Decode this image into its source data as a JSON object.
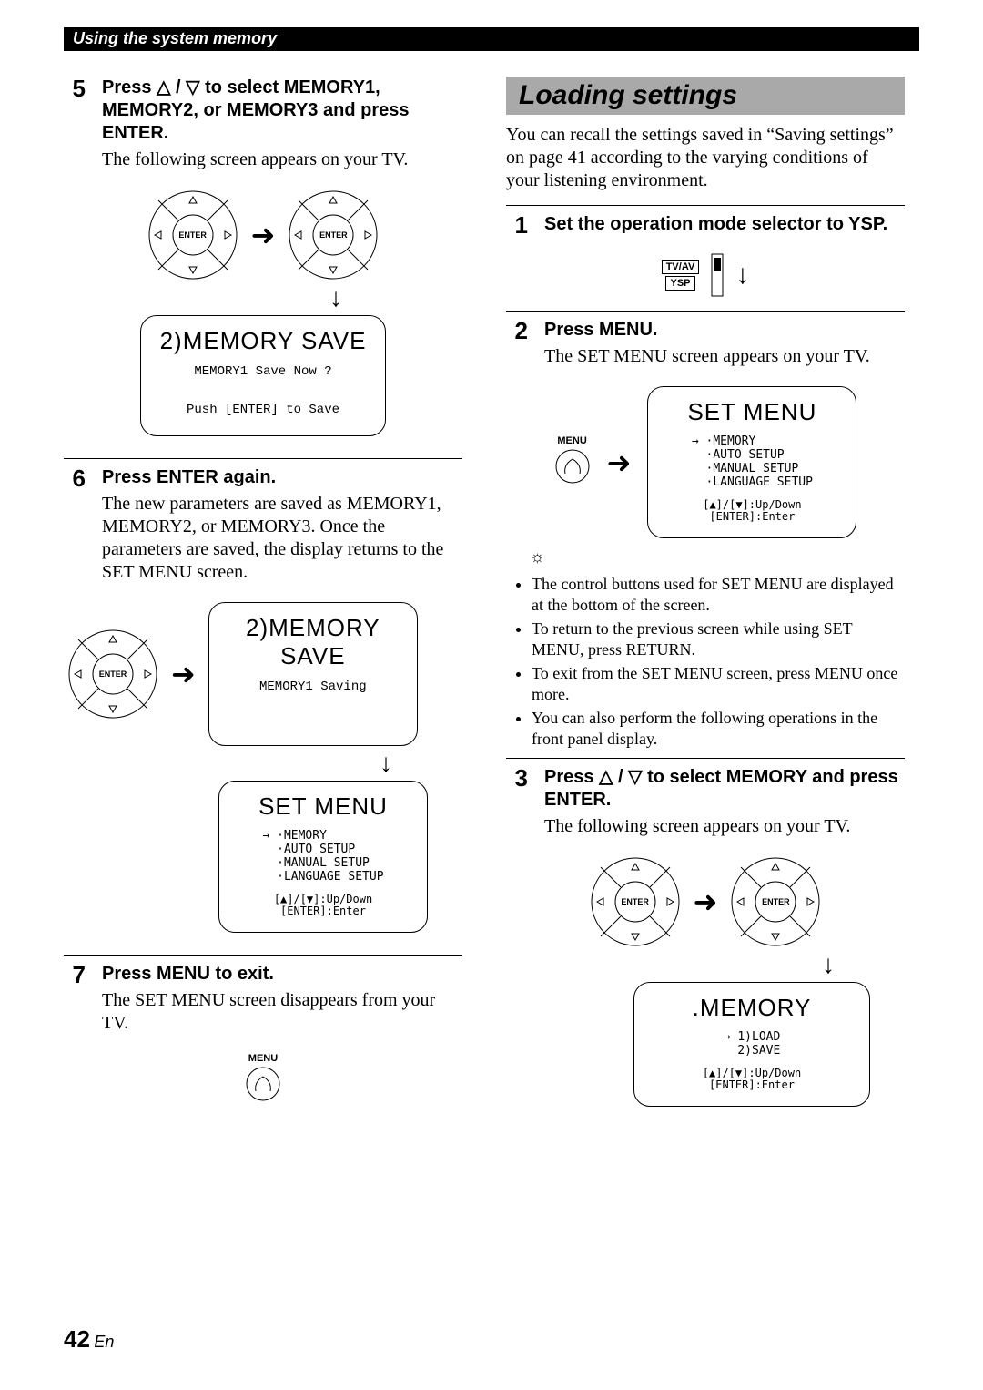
{
  "section_header": "Using the system memory",
  "left": {
    "step5": {
      "num": "5",
      "title_a": "Press ",
      "title_b": " / ",
      "title_c": " to select MEMORY1, MEMORY2, or MEMORY3 and press ENTER.",
      "text": "The following screen appears on your TV.",
      "enter": "ENTER",
      "enter2": "ENTER",
      "tv_title": "2)MEMORY SAVE",
      "tv_line1": "MEMORY1 Save Now ?",
      "tv_line2": "Push [ENTER] to Save"
    },
    "step6": {
      "num": "6",
      "title": "Press ENTER again.",
      "text": "The new parameters are saved as MEMORY1, MEMORY2, or MEMORY3. Once the parameters are saved, the display returns to the SET MENU screen.",
      "enter": "ENTER",
      "tv1_title": "2)MEMORY SAVE",
      "tv1_line1": "MEMORY1 Saving",
      "tv2_title": "SET MENU",
      "tv2_items": "→ ·MEMORY\n  ·AUTO SETUP\n  ·MANUAL SETUP\n  ·LANGUAGE SETUP",
      "tv2_hint": "[▲]/[▼]:Up/Down\n[ENTER]:Enter"
    },
    "step7": {
      "num": "7",
      "title": "Press MENU to exit.",
      "text": "The SET MENU screen disappears from your TV.",
      "menu_label": "MENU"
    }
  },
  "right": {
    "heading": "Loading settings",
    "intro": "You can recall the settings saved in “Saving settings” on page 41 according to the varying conditions of your listening environment.",
    "step1": {
      "num": "1",
      "title": "Set the operation mode selector to YSP.",
      "label_top": "TV/AV",
      "label_bottom": "YSP"
    },
    "step2": {
      "num": "2",
      "title": "Press MENU.",
      "text": "The SET MENU screen appears on your TV.",
      "menu_label": "MENU",
      "tv_title": "SET MENU",
      "tv_items": "→ ·MEMORY\n  ·AUTO SETUP\n  ·MANUAL SETUP\n  ·LANGUAGE SETUP",
      "tv_hint": "[▲]/[▼]:Up/Down\n[ENTER]:Enter",
      "tips": [
        "The control buttons used for SET MENU are displayed at the bottom of the screen.",
        "To return to the previous screen while using SET MENU, press RETURN.",
        "To exit from the SET MENU screen, press MENU once more.",
        "You can also perform the following operations in the front panel display."
      ]
    },
    "step3": {
      "num": "3",
      "title_a": "Press ",
      "title_b": " / ",
      "title_c": " to select MEMORY and press ENTER.",
      "text": "The following screen appears on your TV.",
      "enter": "ENTER",
      "enter2": "ENTER",
      "tv_title": ".MEMORY",
      "tv_items": "→ 1)LOAD\n  2)SAVE",
      "tv_hint": "[▲]/[▼]:Up/Down\n[ENTER]:Enter"
    }
  },
  "page_num": "42",
  "page_lang": "En",
  "icons": {
    "up": "△",
    "down": "▽",
    "arrow_r": "➜",
    "arrow_d": "↓",
    "tip": "☼"
  }
}
